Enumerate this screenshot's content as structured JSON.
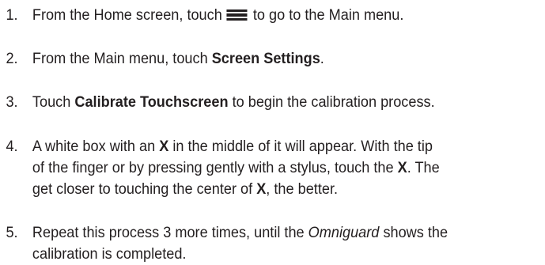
{
  "steps": [
    {
      "number": "1.",
      "text_before_icon": "From the Home screen, touch",
      "icon": "menu-icon",
      "text_after_icon": "to go to the Main menu."
    },
    {
      "number": "2.",
      "text_before": "From the Main menu, touch ",
      "bold": "Screen Settings",
      "text_after": "."
    },
    {
      "number": "3.",
      "text_before": "Touch ",
      "bold": "Calibrate Touchscreen",
      "text_after": " to begin the calibration process."
    },
    {
      "number": "4.",
      "line1_before": "A white box with an ",
      "line1_bold": "X",
      "line1_after": " in the middle of it will appear. With the tip",
      "line2_before": "of the finger or by pressing gently with a stylus, touch the ",
      "line2_bold": "X",
      "line2_after": ". The",
      "line3_before": "get closer to touching the center of ",
      "line3_bold": "X",
      "line3_after": ", the better."
    },
    {
      "number": "5.",
      "line1_before": "Repeat this process 3 more times, until the ",
      "line1_italic": "Omniguard",
      "line1_after": " shows the",
      "line2": "calibration is completed."
    }
  ]
}
